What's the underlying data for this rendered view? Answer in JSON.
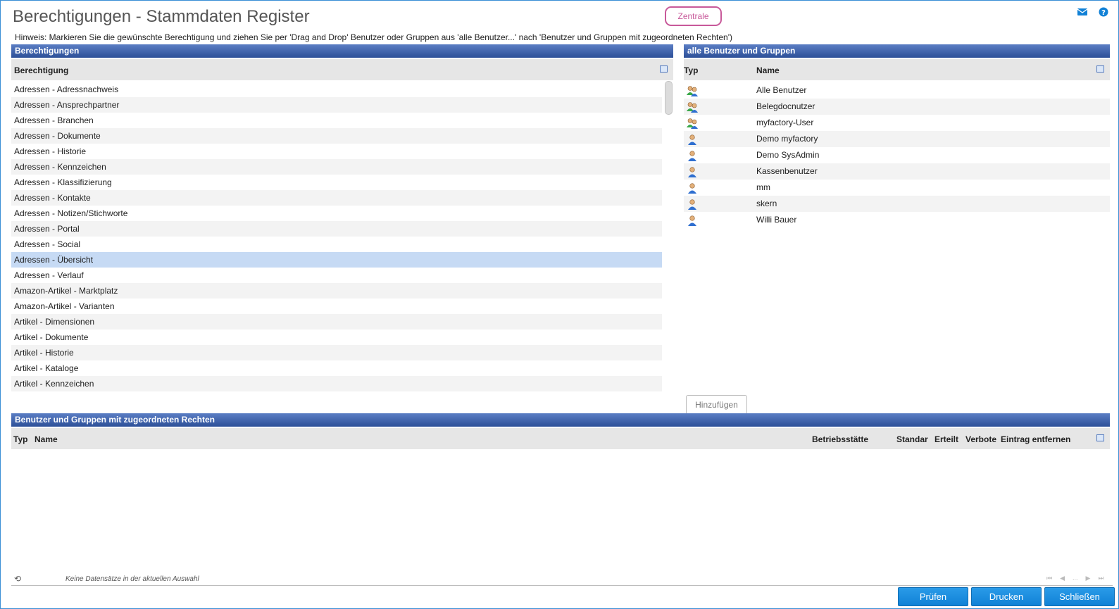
{
  "title": "Berechtigungen - Stammdaten Register",
  "zentrale_label": "Zentrale",
  "hint": "Hinweis: Markieren Sie die gewünschte Berechtigung und ziehen Sie per 'Drag and Drop' Benutzer oder Gruppen aus 'alle Benutzer...' nach 'Benutzer und Gruppen mit zugeordneten Rechten')",
  "left_panel": {
    "header": "Berechtigungen",
    "column": "Berechtigung",
    "selected_index": 11,
    "items": [
      "Adressen - Adressnachweis",
      "Adressen - Ansprechpartner",
      "Adressen - Branchen",
      "Adressen - Dokumente",
      "Adressen - Historie",
      "Adressen - Kennzeichen",
      "Adressen - Klassifizierung",
      "Adressen - Kontakte",
      "Adressen - Notizen/Stichworte",
      "Adressen - Portal",
      "Adressen - Social",
      "Adressen - Übersicht",
      "Adressen - Verlauf",
      "Amazon-Artikel - Marktplatz",
      "Amazon-Artikel - Varianten",
      "Artikel - Dimensionen",
      "Artikel - Dokumente",
      "Artikel - Historie",
      "Artikel - Kataloge",
      "Artikel - Kennzeichen"
    ]
  },
  "right_panel": {
    "header": "alle Benutzer und Gruppen",
    "col_type": "Typ",
    "col_name": "Name",
    "users": [
      {
        "type": "group",
        "name": "Alle Benutzer"
      },
      {
        "type": "group",
        "name": "Belegdocnutzer"
      },
      {
        "type": "group",
        "name": "myfactory-User"
      },
      {
        "type": "user",
        "name": "Demo myfactory"
      },
      {
        "type": "user",
        "name": "Demo SysAdmin"
      },
      {
        "type": "user",
        "name": "Kassenbenutzer"
      },
      {
        "type": "user",
        "name": "mm"
      },
      {
        "type": "user",
        "name": "skern"
      },
      {
        "type": "user",
        "name": "Willi Bauer"
      }
    ],
    "add_button": "Hinzufügen"
  },
  "bottom_panel": {
    "header": "Benutzer und Gruppen mit zugeordneten Rechten",
    "columns": {
      "typ": "Typ",
      "name": "Name",
      "betrieb": "Betriebsstätte",
      "standard": "Standar",
      "erteilt": "Erteilt",
      "verbote": "Verbote",
      "entfernen": "Eintrag entfernen"
    },
    "empty_message": "Keine Datensätze in der aktuellen Auswahl",
    "pager": [
      "⏮",
      "◀",
      "...",
      "▶",
      "⏭"
    ]
  },
  "icons": {
    "mail": "mail-icon",
    "help": "help-icon",
    "refresh": "refresh-icon",
    "column_config": "column-config-icon",
    "group": "user-group-icon",
    "user": "user-icon"
  },
  "colors": {
    "accent": "#1181d6",
    "header_bar": "#2c4f98",
    "zentrale": "#c8599a",
    "selection": "#c6daf4"
  },
  "buttons": {
    "pruefen": "Prüfen",
    "drucken": "Drucken",
    "schliessen": "Schließen"
  }
}
